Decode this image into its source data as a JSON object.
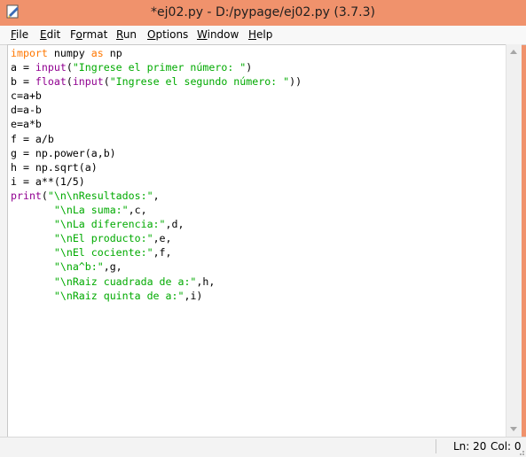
{
  "window": {
    "title": "*ej02.py - D:/pypage/ej02.py (3.7.3)"
  },
  "menu": [
    {
      "label": "File",
      "u": "F",
      "rest": "ile"
    },
    {
      "label": "Edit",
      "u": "E",
      "rest": "dit"
    },
    {
      "label": "Format",
      "u": "F",
      "rest": "ormat",
      "u_after": "o"
    },
    {
      "label": "Run",
      "u": "R",
      "rest": "un"
    },
    {
      "label": "Options",
      "u": "O",
      "rest": "ptions"
    },
    {
      "label": "Window",
      "u": "W",
      "rest": "indow"
    },
    {
      "label": "Help",
      "u": "H",
      "rest": "elp"
    }
  ],
  "code_lines": [
    [
      {
        "t": "import",
        "c": "kw"
      },
      {
        "t": " numpy "
      },
      {
        "t": "as",
        "c": "kw"
      },
      {
        "t": " np"
      }
    ],
    [
      {
        "t": "a = "
      },
      {
        "t": "input",
        "c": "bi"
      },
      {
        "t": "("
      },
      {
        "t": "\"Ingrese el primer número: \"",
        "c": "st"
      },
      {
        "t": ")"
      }
    ],
    [
      {
        "t": "b = "
      },
      {
        "t": "float",
        "c": "bi"
      },
      {
        "t": "("
      },
      {
        "t": "input",
        "c": "bi"
      },
      {
        "t": "("
      },
      {
        "t": "\"Ingrese el segundo número: \"",
        "c": "st"
      },
      {
        "t": "))"
      }
    ],
    [
      {
        "t": "c=a+b"
      }
    ],
    [
      {
        "t": "d=a-b"
      }
    ],
    [
      {
        "t": "e=a*b"
      }
    ],
    [
      {
        "t": "f = a/b"
      }
    ],
    [
      {
        "t": "g = np.power(a,b)"
      }
    ],
    [
      {
        "t": "h = np.sqrt(a)"
      }
    ],
    [
      {
        "t": "i = a**(1/5)"
      }
    ],
    [
      {
        "t": "print",
        "c": "bi"
      },
      {
        "t": "("
      },
      {
        "t": "\"\\n\\nResultados:\"",
        "c": "st"
      },
      {
        "t": ","
      }
    ],
    [
      {
        "t": "       "
      },
      {
        "t": "\"\\nLa suma:\"",
        "c": "st"
      },
      {
        "t": ",c,"
      }
    ],
    [
      {
        "t": "       "
      },
      {
        "t": "\"\\nLa diferencia:\"",
        "c": "st"
      },
      {
        "t": ",d,"
      }
    ],
    [
      {
        "t": "       "
      },
      {
        "t": "\"\\nEl producto:\"",
        "c": "st"
      },
      {
        "t": ",e,"
      }
    ],
    [
      {
        "t": "       "
      },
      {
        "t": "\"\\nEl cociente:\"",
        "c": "st"
      },
      {
        "t": ",f,"
      }
    ],
    [
      {
        "t": "       "
      },
      {
        "t": "\"\\na^b:\"",
        "c": "st"
      },
      {
        "t": ",g,"
      }
    ],
    [
      {
        "t": "       "
      },
      {
        "t": "\"\\nRaiz cuadrada de a:\"",
        "c": "st"
      },
      {
        "t": ",h,"
      }
    ],
    [
      {
        "t": "       "
      },
      {
        "t": "\"\\nRaiz quinta de a:\"",
        "c": "st"
      },
      {
        "t": ",i)"
      }
    ]
  ],
  "status": {
    "line": "Ln: 20",
    "col": "Col: 0"
  },
  "colors": {
    "titlebar": "#f0926c",
    "keyword": "#ff7700",
    "builtin": "#900090",
    "string": "#00aa00"
  }
}
